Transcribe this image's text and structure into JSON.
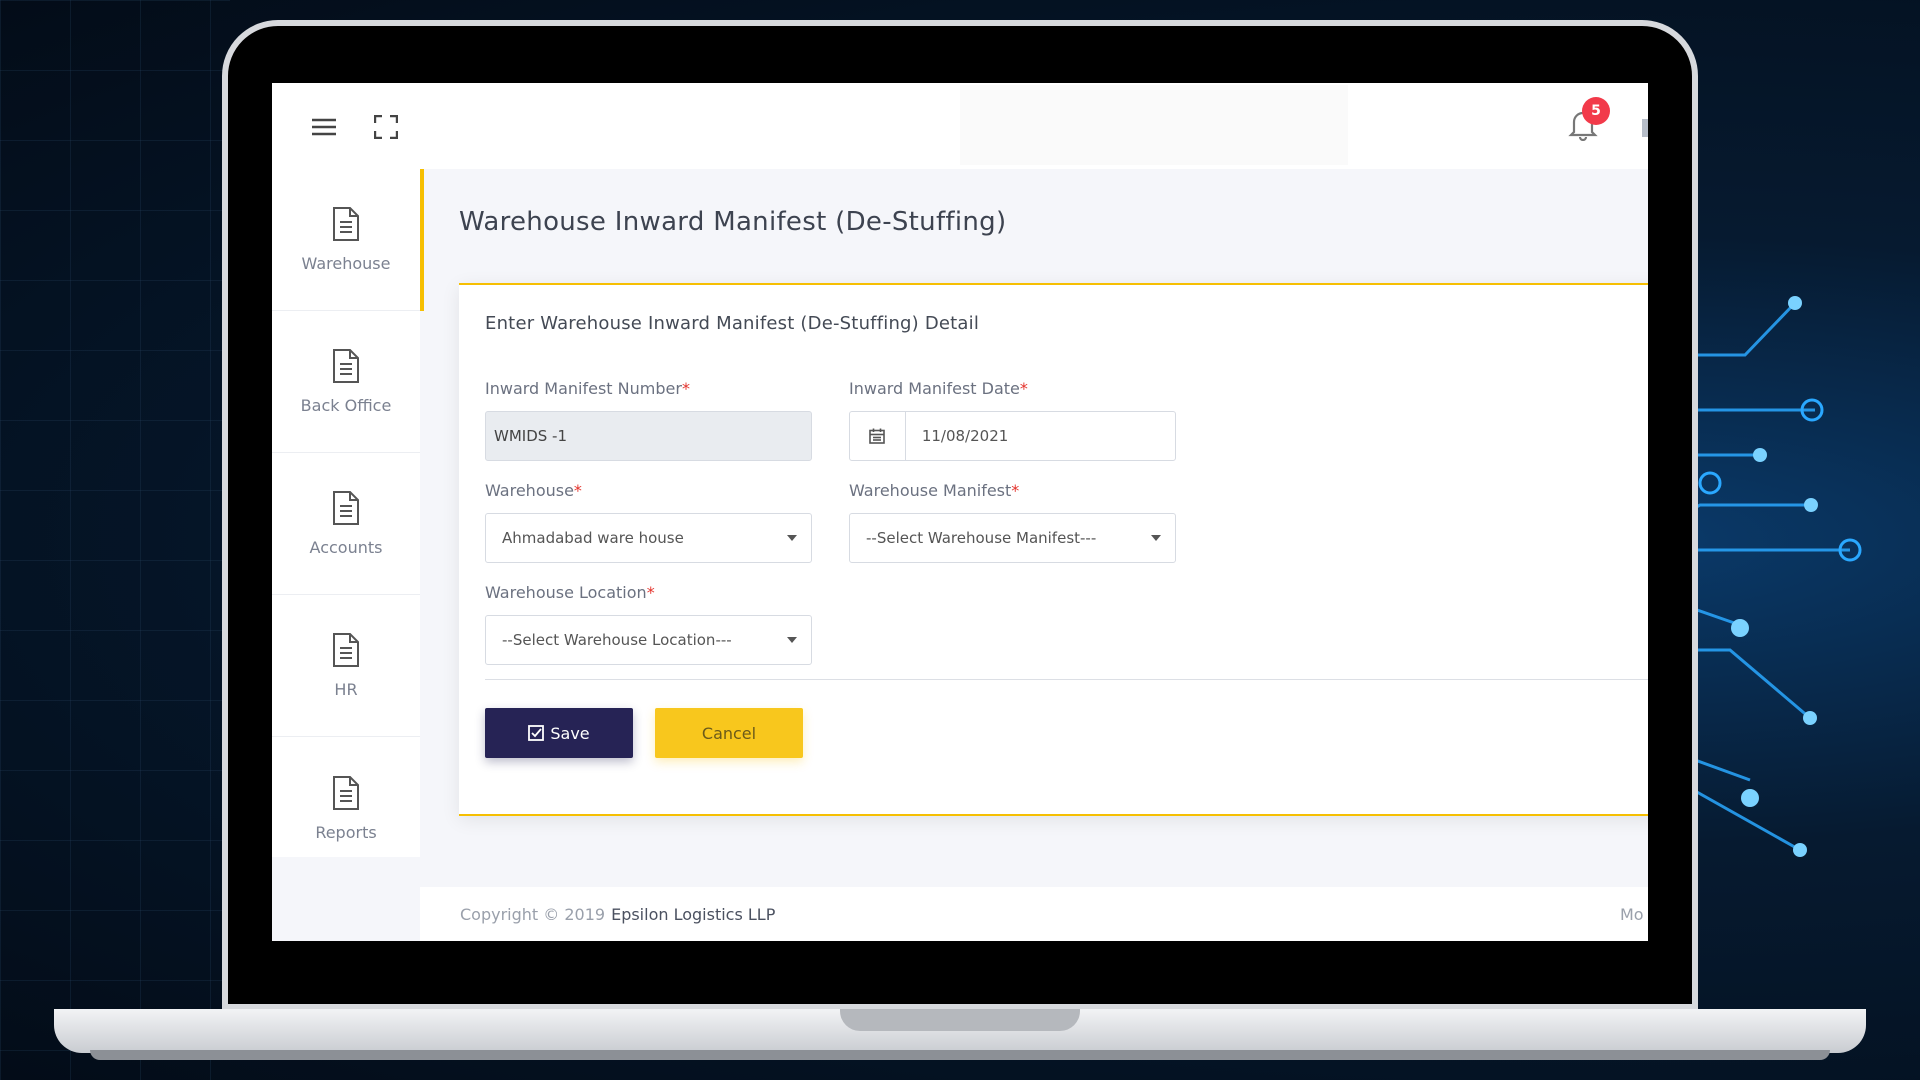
{
  "header": {
    "menu_icon": "hamburger-icon",
    "fullscreen_icon": "expand-icon",
    "notification_count": "5"
  },
  "sidebar": {
    "items": [
      {
        "label": "Warehouse",
        "icon": "document-icon",
        "active": true
      },
      {
        "label": "Back Office",
        "icon": "document-icon",
        "active": false
      },
      {
        "label": "Accounts",
        "icon": "document-icon",
        "active": false
      },
      {
        "label": "HR",
        "icon": "document-icon",
        "active": false
      },
      {
        "label": "Reports",
        "icon": "document-icon",
        "active": false
      }
    ]
  },
  "page": {
    "title": "Warehouse Inward Manifest (De-Stuffing)",
    "card_title": "Enter Warehouse Inward Manifest (De-Stuffing) Detail"
  },
  "form": {
    "manifest_number": {
      "label": "Inward Manifest Number",
      "value": "WMIDS -1"
    },
    "manifest_date": {
      "label": "Inward Manifest Date",
      "value": "11/08/2021"
    },
    "warehouse": {
      "label": "Warehouse",
      "value": "Ahmadabad ware house"
    },
    "warehouse_manifest": {
      "label": "Warehouse Manifest",
      "value": "--Select Warehouse Manifest---"
    },
    "warehouse_location": {
      "label": "Warehouse Location",
      "value": "--Select Warehouse Location---"
    },
    "required_mark": "*"
  },
  "actions": {
    "save_label": "Save",
    "cancel_label": "Cancel"
  },
  "footer": {
    "copyright": "Copyright © 2019",
    "company": "Epsilon Logistics LLP",
    "right_text": "Mo"
  },
  "colors": {
    "accent": "#f6bf02",
    "save_button": "#262355",
    "cancel_button": "#f8c71d",
    "badge": "#f23a4a"
  }
}
